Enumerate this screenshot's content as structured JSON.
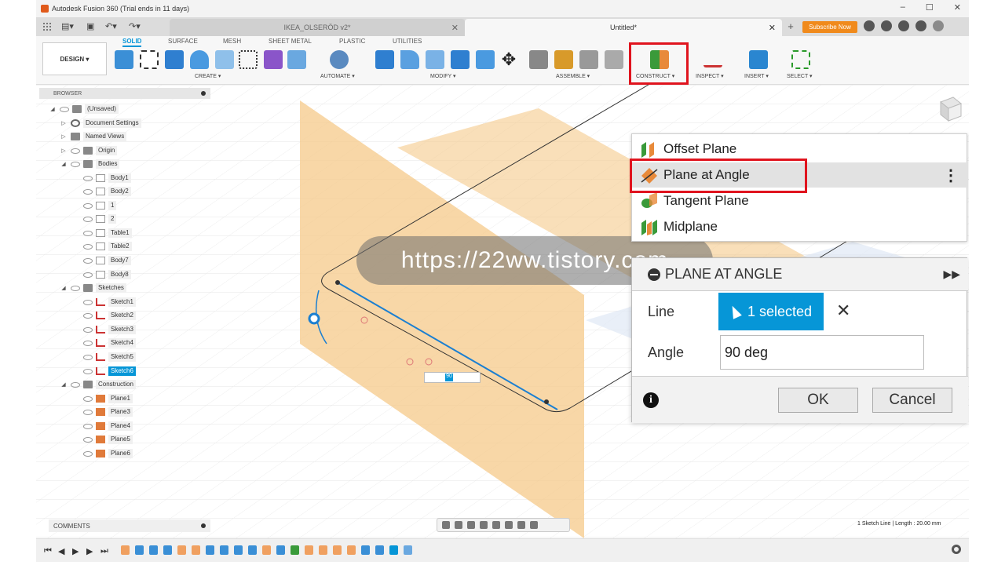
{
  "titlebar": {
    "title": "Autodesk Fusion 360 (Trial ends in 11 days)"
  },
  "tabs": [
    {
      "label": "IKEA_OLSERÖD v2*"
    },
    {
      "label": "Untitled*"
    }
  ],
  "subscribe_label": "Subscribe Now",
  "toolbar": {
    "design_label": "DESIGN ▾",
    "workspace_tabs": [
      "SOLID",
      "SURFACE",
      "MESH",
      "SHEET METAL",
      "PLASTIC",
      "UTILITIES"
    ],
    "groups": [
      "CREATE ▾",
      "AUTOMATE ▾",
      "MODIFY ▾",
      "ASSEMBLE ▾",
      "CONSTRUCT ▾",
      "INSPECT ▾",
      "INSERT ▾",
      "SELECT ▾"
    ]
  },
  "browser": {
    "header": "BROWSER",
    "items": [
      {
        "label": "(Unsaved)"
      },
      {
        "label": "Document Settings"
      },
      {
        "label": "Named Views"
      },
      {
        "label": "Origin"
      },
      {
        "label": "Bodies"
      },
      {
        "label": "Body1"
      },
      {
        "label": "Body2"
      },
      {
        "label": "1"
      },
      {
        "label": "2"
      },
      {
        "label": "Table1"
      },
      {
        "label": "Table2"
      },
      {
        "label": "Body7"
      },
      {
        "label": "Body8"
      },
      {
        "label": "Sketches"
      },
      {
        "label": "Sketch1"
      },
      {
        "label": "Sketch2"
      },
      {
        "label": "Sketch3"
      },
      {
        "label": "Sketch4"
      },
      {
        "label": "Sketch5"
      },
      {
        "label": "Sketch6"
      },
      {
        "label": "Construction"
      },
      {
        "label": "Plane1"
      },
      {
        "label": "Plane3"
      },
      {
        "label": "Plane4"
      },
      {
        "label": "Plane5"
      },
      {
        "label": "Plane6"
      }
    ]
  },
  "comments_label": "COMMENTS",
  "construct_menu": {
    "items": [
      {
        "label": "Offset Plane"
      },
      {
        "label": "Plane at Angle"
      },
      {
        "label": "Tangent Plane"
      },
      {
        "label": "Midplane"
      }
    ]
  },
  "dialog": {
    "title": "PLANE AT ANGLE",
    "line_label": "Line",
    "selection_label": "1 selected",
    "angle_label": "Angle",
    "angle_value": "90 deg",
    "ok_label": "OK",
    "cancel_label": "Cancel"
  },
  "mini_input_value": "90",
  "watermark": "https://22ww.tistory.com",
  "status_text": "1 Sketch Line | Length : 20.00 mm",
  "colors": {
    "accent": "#0696d7",
    "highlight": "#e0141e",
    "plane": "#f5c98a"
  }
}
